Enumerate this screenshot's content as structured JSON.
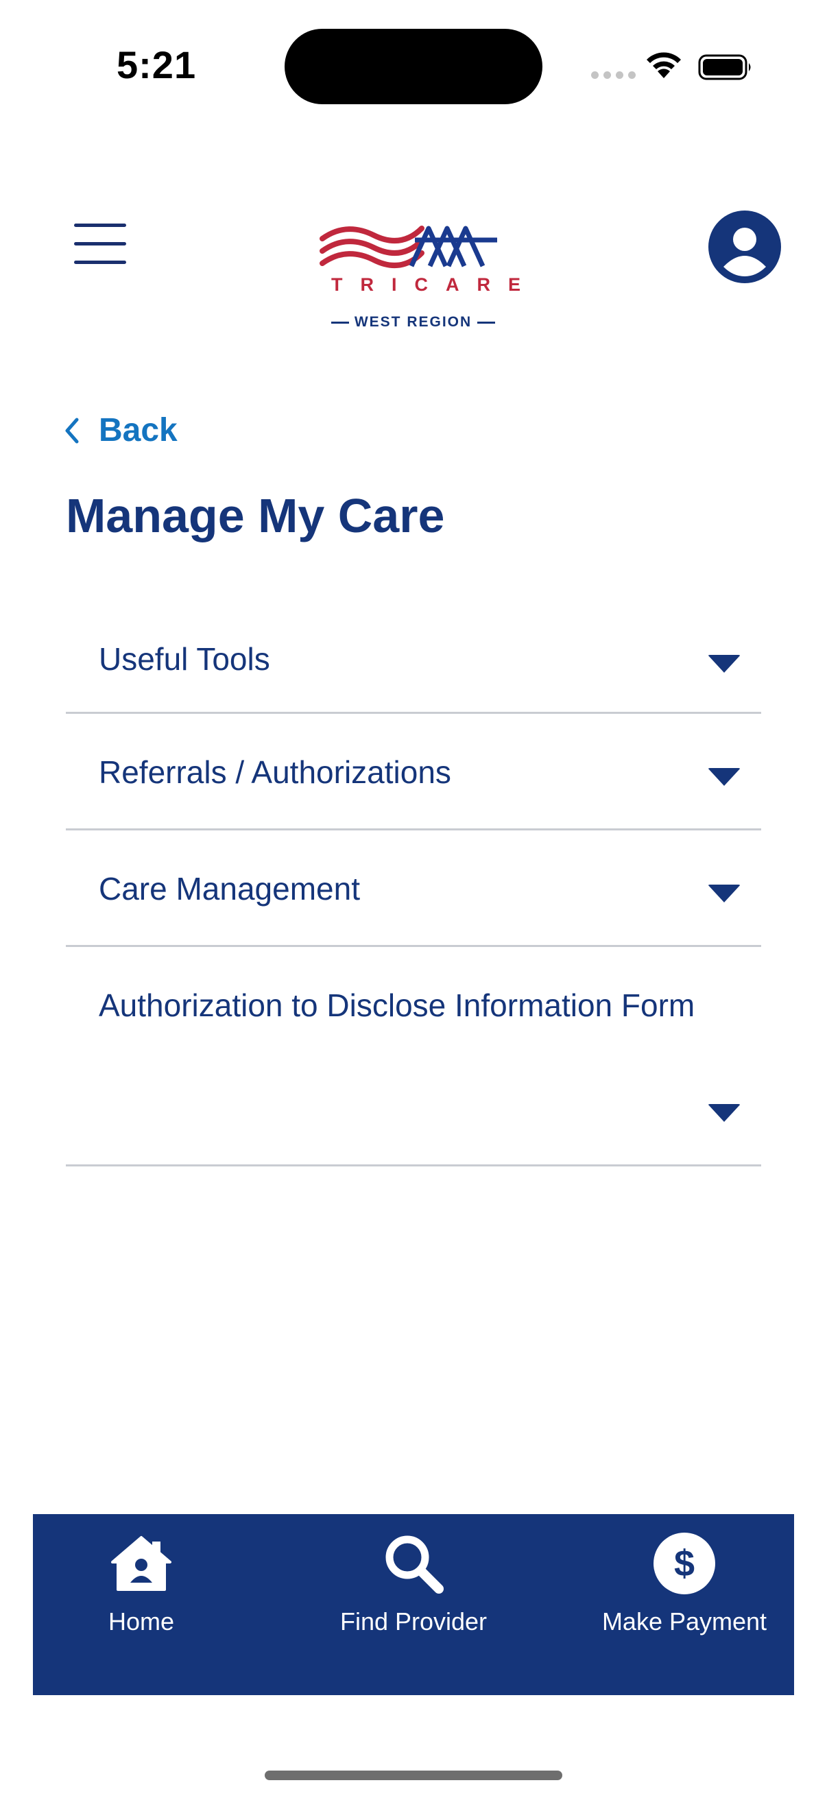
{
  "status_bar": {
    "time": "5:21"
  },
  "header": {
    "menu_icon": "hamburger-icon",
    "logo": {
      "brand": "TRICARE",
      "region": "WEST REGION"
    },
    "profile_icon": "user-icon"
  },
  "back": {
    "label": "Back",
    "icon": "chevron-left-icon"
  },
  "page": {
    "title": "Manage My Care"
  },
  "accordion": {
    "items": [
      {
        "label": "Useful Tools",
        "icon": "caret-down-icon"
      },
      {
        "label": "Referrals / Authorizations",
        "icon": "caret-down-icon"
      },
      {
        "label": "Care Management",
        "icon": "caret-down-icon"
      },
      {
        "label": "Authorization to Disclose Information Form",
        "icon": "caret-down-icon"
      }
    ]
  },
  "bottom_nav": {
    "items": [
      {
        "label": "Home",
        "icon": "home-icon"
      },
      {
        "label": "Find Provider",
        "icon": "search-icon"
      },
      {
        "label": "Make Payment",
        "icon": "dollar-icon"
      }
    ]
  },
  "colors": {
    "primary": "#15357a",
    "link": "#1474c0",
    "brand_red": "#c0283d",
    "divider": "#c9ccd2"
  }
}
